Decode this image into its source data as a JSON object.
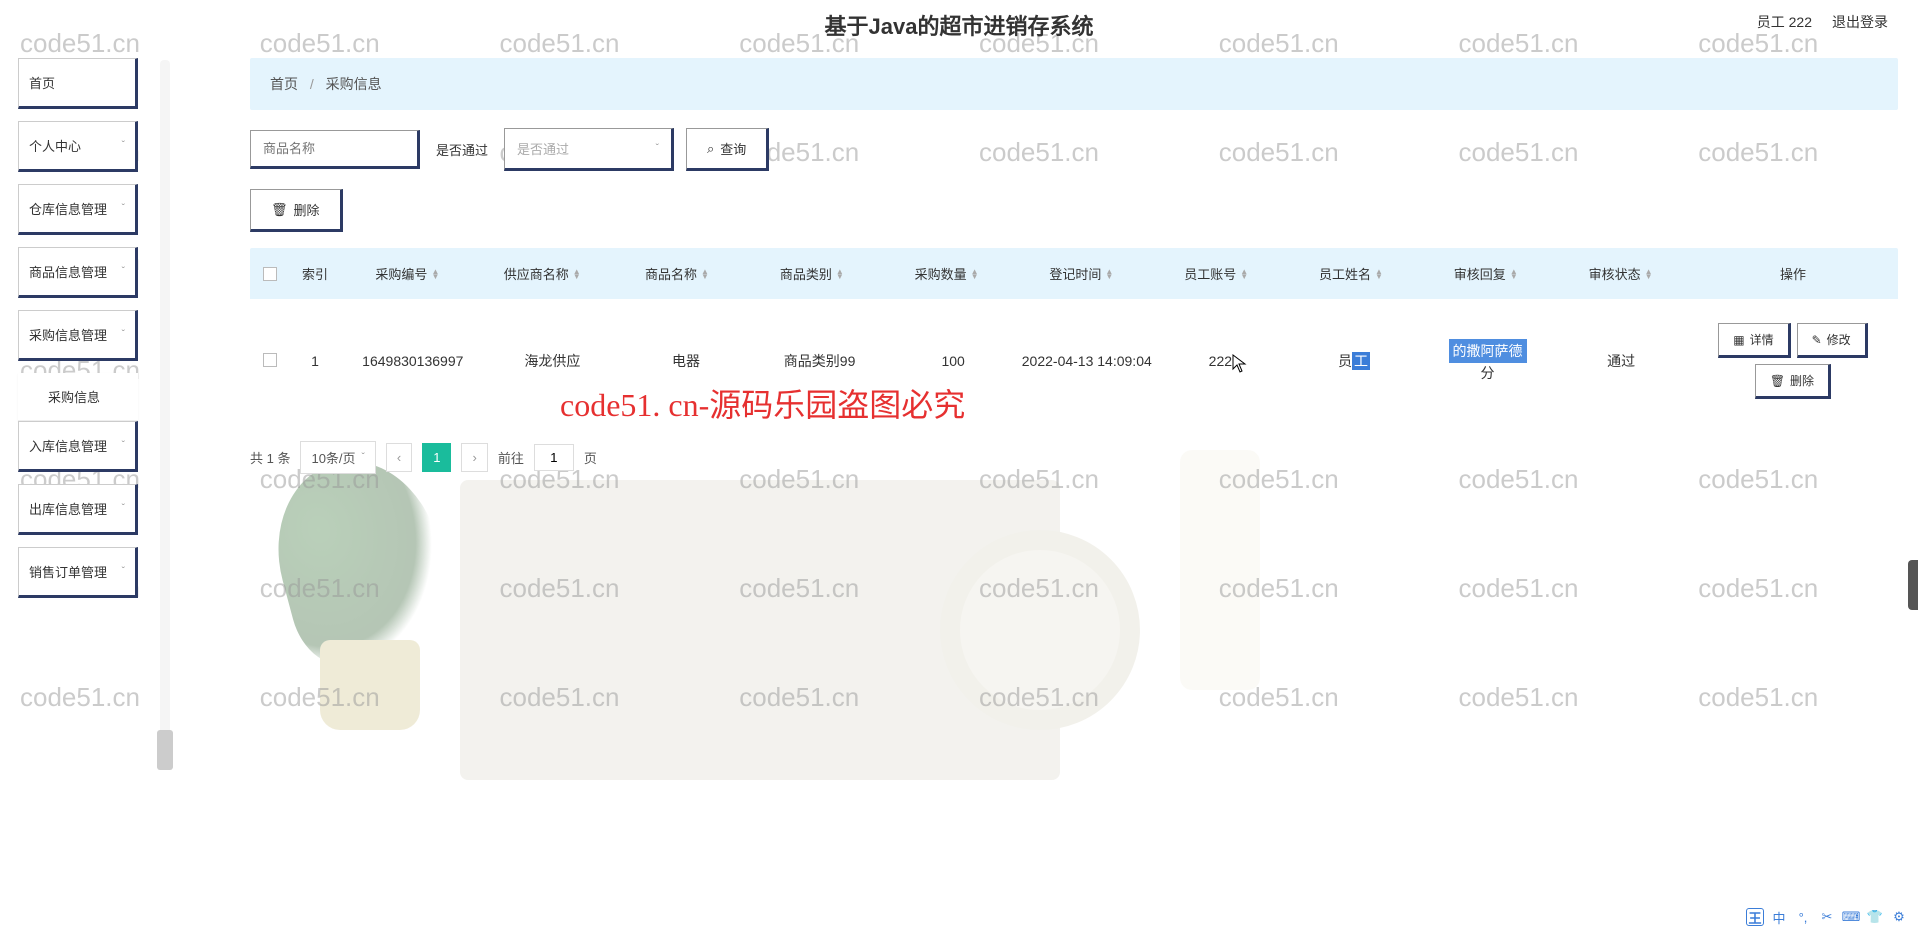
{
  "header": {
    "title": "基于Java的超市进销存系统",
    "user_label": "员工 222",
    "logout": "退出登录"
  },
  "sidebar": {
    "items": [
      {
        "label": "首页",
        "expandable": false
      },
      {
        "label": "个人中心",
        "expandable": true
      },
      {
        "label": "仓库信息管理",
        "expandable": true
      },
      {
        "label": "商品信息管理",
        "expandable": true
      },
      {
        "label": "采购信息管理",
        "expandable": true
      },
      {
        "label": "采购信息",
        "expandable": false,
        "sub": true
      },
      {
        "label": "入库信息管理",
        "expandable": true
      },
      {
        "label": "出库信息管理",
        "expandable": true
      },
      {
        "label": "销售订单管理",
        "expandable": true
      }
    ]
  },
  "breadcrumb": {
    "home": "首页",
    "current": "采购信息"
  },
  "search": {
    "name_placeholder": "商品名称",
    "pass_label": "是否通过",
    "pass_placeholder": "是否通过",
    "query_btn": "查询"
  },
  "actions": {
    "delete_btn": "删除"
  },
  "table": {
    "headers": {
      "index": "索引",
      "purchase_no": "采购编号",
      "supplier": "供应商名称",
      "product_name": "商品名称",
      "product_cat": "商品类别",
      "quantity": "采购数量",
      "reg_time": "登记时间",
      "emp_account": "员工账号",
      "emp_name": "员工姓名",
      "review_reply": "审核回复",
      "review_status": "审核状态",
      "operation": "操作"
    },
    "rows": [
      {
        "index": "1",
        "purchase_no": "1649830136997",
        "supplier": "海龙供应",
        "product_name": "电器",
        "product_cat": "商品类别99",
        "quantity": "100",
        "reg_time": "2022-04-13 14:09:04",
        "emp_account": "222",
        "emp_name_prefix": "员",
        "emp_name_hl": "工",
        "review_reply_hl": "的撒阿萨德",
        "review_reply_suffix": "分",
        "review_status": "通过"
      }
    ],
    "row_actions": {
      "detail": "详情",
      "edit": "修改",
      "delete": "删除"
    }
  },
  "pagination": {
    "total_label": "共 1 条",
    "per_page": "10条/页",
    "current": "1",
    "goto_prefix": "前往",
    "goto_value": "1",
    "goto_suffix": "页"
  },
  "watermark": "code51.cn",
  "red_watermark": "code51. cn-源码乐园盗图必究"
}
